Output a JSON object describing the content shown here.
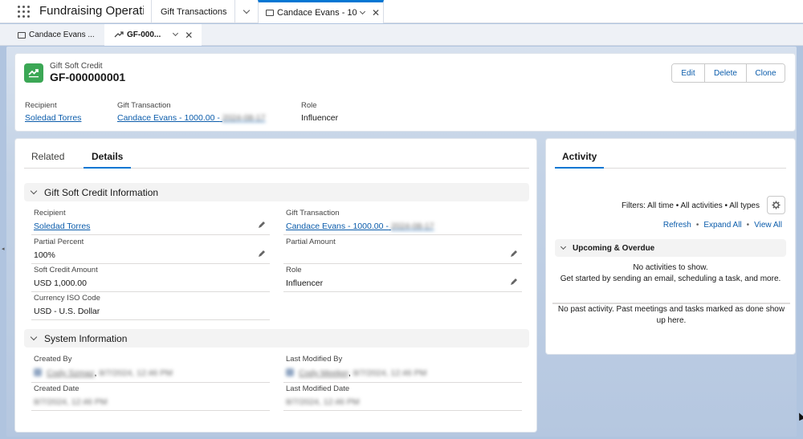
{
  "nav": {
    "app_name": "Fundraising Operati...",
    "tabs": [
      {
        "label": "Gift Transactions"
      },
      {
        "label": "Candace Evans - 10..."
      }
    ]
  },
  "subtabs": [
    {
      "label": "Candace Evans ..."
    },
    {
      "label": "GF-000..."
    }
  ],
  "header": {
    "object_type": "Gift Soft Credit",
    "title": "GF-000000001",
    "actions": {
      "edit": "Edit",
      "delete": "Delete",
      "clone": "Clone"
    },
    "fields": {
      "recipient_label": "Recipient",
      "recipient_value": "Soledad Torres",
      "gift_label": "Gift Transaction",
      "gift_value": "Candace Evans - 1000.00 -",
      "gift_value_blurred": "2024-08-17",
      "role_label": "Role",
      "role_value": "Influencer"
    }
  },
  "details": {
    "tabs": {
      "related": "Related",
      "details": "Details"
    },
    "section1": {
      "title": "Gift Soft Credit Information",
      "fields": [
        {
          "label": "Recipient",
          "value": "Soledad Torres"
        },
        {
          "label": "Gift Transaction",
          "value": "Candace Evans - 1000.00 -",
          "blurred": "2024-08-17"
        },
        {
          "label": "Partial Percent",
          "value": "100%"
        },
        {
          "label": "Partial Amount",
          "value": ""
        },
        {
          "label": "Soft Credit Amount",
          "value": "USD 1,000.00"
        },
        {
          "label": "Role",
          "value": "Influencer"
        },
        {
          "label": "Currency ISO Code",
          "value": "USD - U.S. Dollar"
        }
      ]
    },
    "section2": {
      "title": "System Information",
      "fields": [
        {
          "label": "Created By",
          "user": "Cody Szmaz",
          "date": "8/7/2024, 12:46 PM"
        },
        {
          "label": "Last Modified By",
          "user": "Cody Meeker",
          "date": "8/7/2024, 12:46 PM"
        },
        {
          "label": "Created Date",
          "value": "8/7/2024, 12:46 PM"
        },
        {
          "label": "Last Modified Date",
          "value": "8/7/2024, 12:46 PM"
        }
      ]
    }
  },
  "activity": {
    "tab": "Activity",
    "filters": "Filters: All time • All activities • All types",
    "links": {
      "refresh": "Refresh",
      "expand_all": "Expand All",
      "view_all": "View All"
    },
    "upcoming": {
      "title": "Upcoming & Overdue",
      "empty": "No activities to show.",
      "hint": "Get started by sending an email, scheduling a task, and more."
    },
    "past": "No past activity. Past meetings and tasks marked as done show up here."
  },
  "colors": {
    "accent": "#0176d3",
    "link": "#0b5cab",
    "object_icon": "#3ba755",
    "background": "#b0c4df"
  }
}
